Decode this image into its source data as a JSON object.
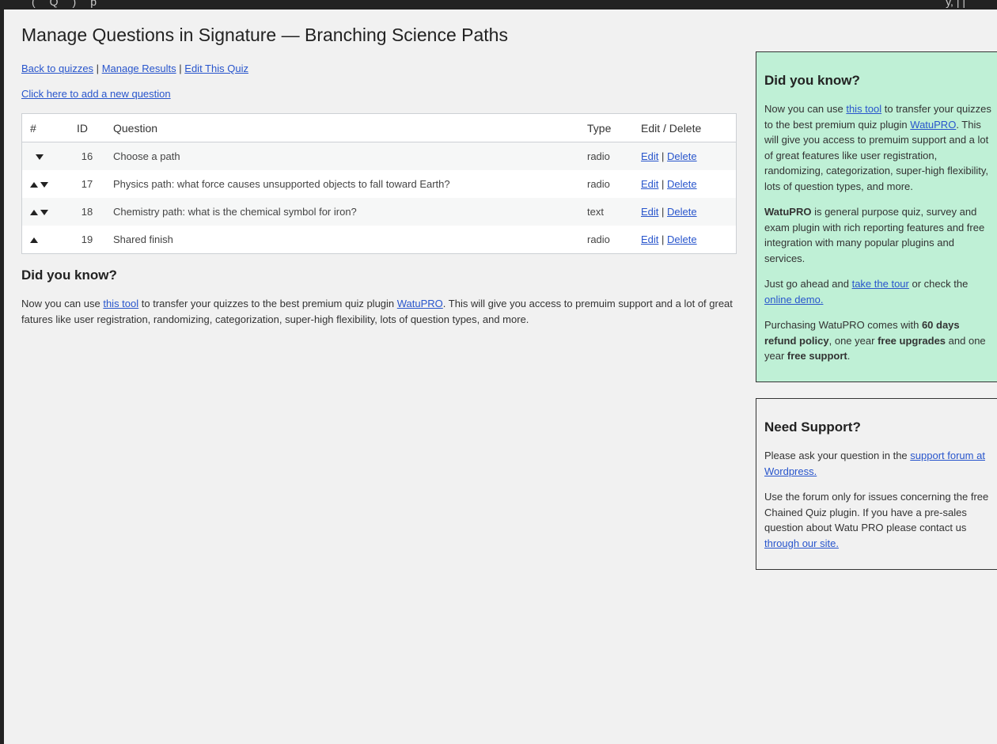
{
  "page": {
    "title": "Manage Questions in Signature — Branching Science Paths"
  },
  "nav": {
    "back": "Back to quizzes",
    "manage_results": "Manage Results",
    "edit_quiz": "Edit This Quiz",
    "separator": "|",
    "add_question": "Click here to add a new question"
  },
  "table": {
    "headers": {
      "num": "#",
      "id": "ID",
      "question": "Question",
      "type": "Type",
      "edit_delete": "Edit / Delete"
    },
    "rows": [
      {
        "id": "16",
        "question": "Choose a path",
        "type": "radio",
        "edit": "Edit",
        "delete": "Delete",
        "sep": "|"
      },
      {
        "id": "17",
        "question": "Physics path: what force causes unsupported objects to fall toward Earth?",
        "type": "radio",
        "edit": "Edit",
        "delete": "Delete",
        "sep": "|"
      },
      {
        "id": "18",
        "question": "Chemistry path: what is the chemical symbol for iron?",
        "type": "text",
        "edit": "Edit",
        "delete": "Delete",
        "sep": "|"
      },
      {
        "id": "19",
        "question": "Shared finish",
        "type": "radio",
        "edit": "Edit",
        "delete": "Delete",
        "sep": "|"
      }
    ]
  },
  "main_dyk": {
    "title": "Did you know?",
    "t1": "Now you can use ",
    "link_tool": "this tool",
    "t2": " to transfer your quizzes to the best premium quiz plugin ",
    "link_watupro": "WatuPRO",
    "t3": ". This will give you access to premuim support and a lot of great fatures like user registration, randomizing, categorization, super-high flexibility, lots of question types, and more."
  },
  "side_dyk": {
    "title": "Did you know?",
    "p1_t1": "Now you can use ",
    "p1_link_tool": "this tool",
    "p1_t2": " to transfer your quizzes to the best premium quiz plugin ",
    "p1_link_watupro": "WatuPRO",
    "p1_t3": ". This will give you access to premuim support and a lot of great features like user registration, randomizing, categorization, super-high flexibility, lots of question types, and more.",
    "p2_bold": "WatuPRO",
    "p2_text": " is general purpose quiz, survey and exam plugin with rich reporting features and free integration with many popular plugins and services.",
    "p3_t1": "Just go ahead and ",
    "p3_link_tour": "take the tour",
    "p3_t2": " or check the ",
    "p3_link_demo": "online demo.",
    "p4_t1": "Purchasing WatuPRO comes with ",
    "p4_b1": "60 days refund policy",
    "p4_t2": ", one year ",
    "p4_b2": "free upgrades",
    "p4_t3": " and one year ",
    "p4_b3": "free support",
    "p4_t4": "."
  },
  "support": {
    "title": "Need Support?",
    "p1_t1": "Please ask your question in the ",
    "p1_link": "support forum at Wordpress.",
    "p2_t1": "Use the forum only for issues concerning the free Chained Quiz plugin. If you have a pre-sales question about Watu PRO please contact us ",
    "p2_link": "through our site."
  }
}
